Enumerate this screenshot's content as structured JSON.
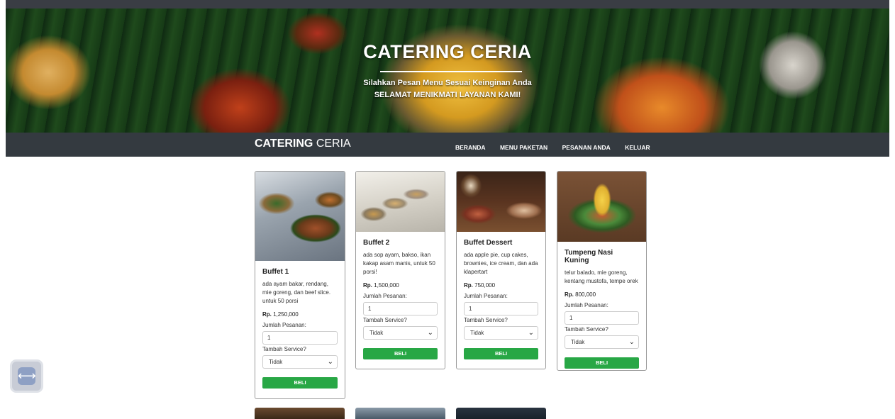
{
  "hero": {
    "title": "CATERING CERIA",
    "subtitle_line1": "Silahkan Pesan Menu Sesuai Keinginan Anda",
    "subtitle_line2": "SELAMAT MENIKMATI LAYANAN KAMI!"
  },
  "navbar": {
    "brand_bold": "CATERING",
    "brand_light": " CERIA",
    "links": [
      "BERANDA",
      "MENU PAKETAN",
      "PESANAN ANDA",
      "KELUAR"
    ]
  },
  "common": {
    "qty_label": "Jumlah Pesanan:",
    "service_label": "Tambah Service?",
    "buy_label": "BELI"
  },
  "products": [
    {
      "name": "Buffet 1",
      "description": "ada ayam bakar, rendang, mie goreng, dan beef slice. untuk 50 porsi",
      "price": "Rp. 1,250,000",
      "quantity": "1",
      "service": "Tidak",
      "image_icon": "buffet-trays-photo"
    },
    {
      "name": "Buffet 2",
      "description": "ada sop ayam, bakso, ikan kakap asam manis, untuk 50 porsi!",
      "price": "Rp. 1,500,000",
      "quantity": "1",
      "service": "Tidak",
      "image_icon": "buffet-line-photo"
    },
    {
      "name": "Buffet Dessert",
      "description": "ada apple pie, cup cakes, brownies, ice cream, dan ada klapertart",
      "price": "Rp. 750,000",
      "quantity": "1",
      "service": "Tidak",
      "image_icon": "dessert-table-photo"
    },
    {
      "name": "Tumpeng Nasi Kuning",
      "description": "telur balado, mie goreng, kentang mustofa, tempe orek",
      "price": "Rp. 800,000",
      "quantity": "1",
      "service": "Tidak",
      "image_icon": "tumpeng-photo"
    }
  ],
  "price_prefix": "Rp.",
  "fab_icon": "lightning-bolt-icon",
  "colors": {
    "navbar": "#343a40",
    "buy_button": "#28a745"
  }
}
